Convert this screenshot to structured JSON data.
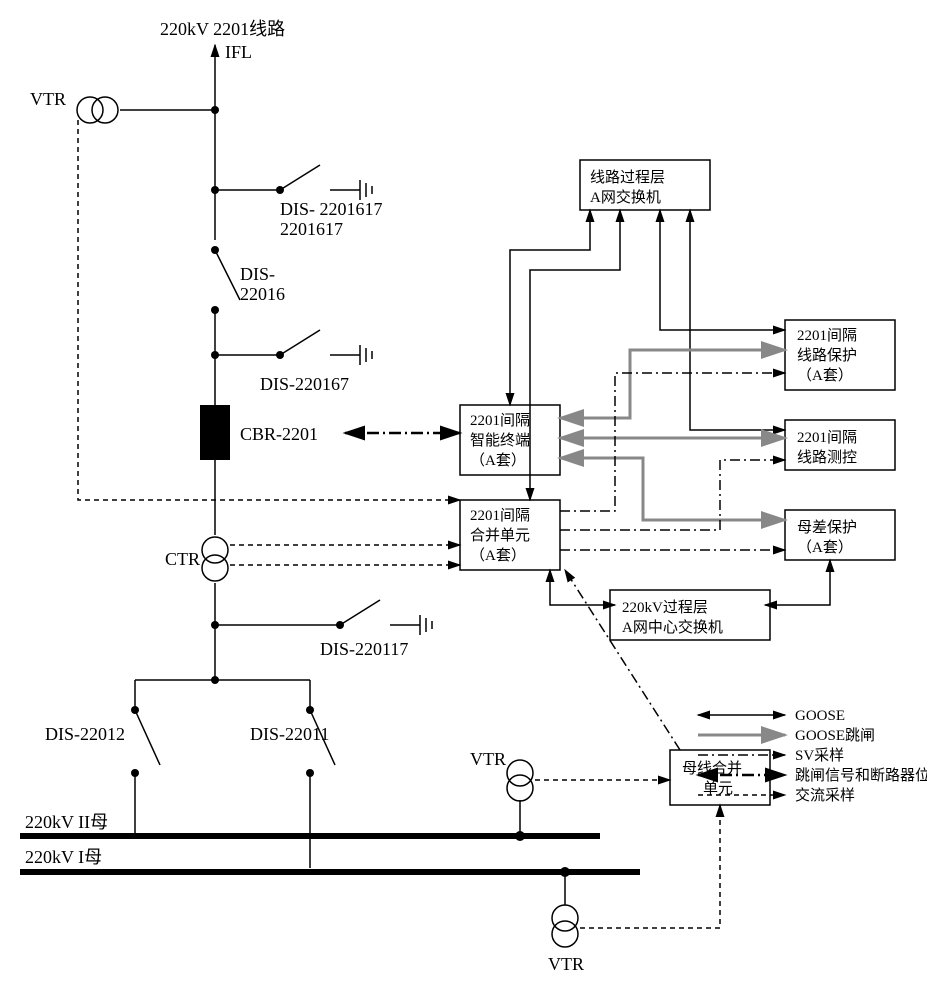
{
  "title": "220kV 2201线路",
  "ifl": "IFL",
  "vtr": "VTR",
  "ctr": "CTR",
  "devices": {
    "dis2201617": "DIS-\n2201617",
    "dis22016": "DIS-\n22016",
    "dis220167": "DIS-220167",
    "cbr2201": "CBR-2201",
    "dis220117": "DIS-220117",
    "dis22012": "DIS-22012",
    "dis22011": "DIS-22011"
  },
  "boxes": {
    "lineProcSwitch": "线路过程层\nA网交换机",
    "bay2201IntTerm": "2201间隔\n智能终端\n（A套）",
    "bay2201MergeUnit": "2201间隔\n合并单元\n（A套）",
    "bay2201LineProtect": "2201间隔\n线路保护\n（A套）",
    "bay2201LineMC": "2201间隔\n线路测控",
    "busDiffProtect": "母差保护\n（A套）",
    "procCenterSwitch": "220kV过程层\nA网中心交换机",
    "busMergeUnit": "母线合并\n单元"
  },
  "buses": {
    "bus2": "220kV II母",
    "bus1": "220kV I母"
  },
  "legend": {
    "goose": "GOOSE",
    "gooseTrip": "GOOSE跳闸",
    "svSample": "SV采样",
    "tripBreaker": "跳闸信号和断路器位置",
    "acSample": "交流采样"
  }
}
